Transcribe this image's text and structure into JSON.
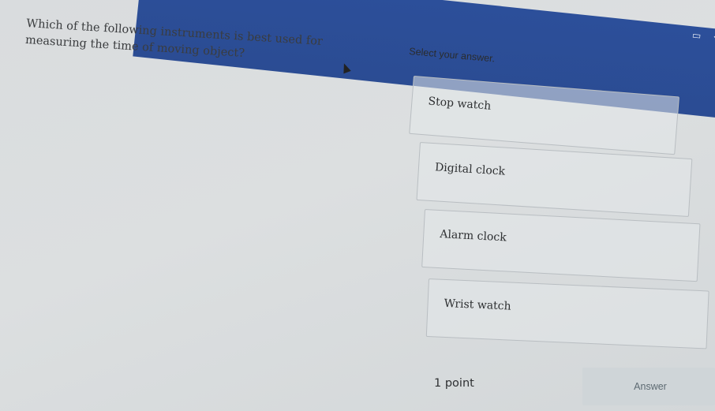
{
  "question": {
    "text": "Which of the following instruments is best used for measuring the time of moving object?"
  },
  "prompt": "Select your answer.",
  "options": [
    {
      "label": "Stop watch"
    },
    {
      "label": "Digital clock"
    },
    {
      "label": "Alarm clock"
    },
    {
      "label": "Wrist watch"
    }
  ],
  "footer": {
    "points": "1 point",
    "answer_button": "Answer"
  },
  "header": {
    "icons": [
      "tablet-icon",
      "undo-icon",
      "redo-icon",
      "more-icon"
    ],
    "bar_color": "#2c4f9a"
  }
}
